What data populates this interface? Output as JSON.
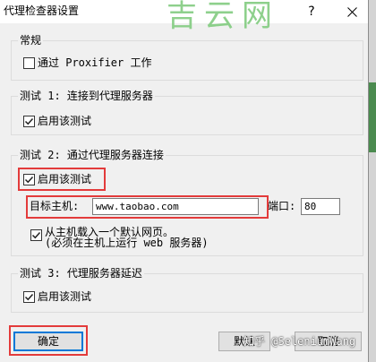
{
  "window": {
    "title": "代理检查器设置",
    "help_button": "?",
    "close_icon": "close-icon"
  },
  "watermarks": {
    "top": "吉云网",
    "bottom": "知乎 @SeleniumWang"
  },
  "groups": {
    "general": {
      "title": "常规",
      "work_through_proxifier": {
        "label": "通过 Proxifier 工作",
        "checked": false
      }
    },
    "test1": {
      "title": "测试 1: 连接到代理服务器",
      "enable": {
        "label": "启用该测试",
        "checked": true
      }
    },
    "test2": {
      "title": "测试 2: 通过代理服务器连接",
      "enable": {
        "label": "启用该测试",
        "checked": true
      },
      "target_host": {
        "label": "目标主机:",
        "value": "www.taobao.com"
      },
      "port": {
        "label": "端口:",
        "value": "80"
      },
      "load_default_page": {
        "label_line1": "从主机载入一个默认网页。",
        "label_line2": "(必须在主机上运行 web 服务器)",
        "checked": true
      }
    },
    "test3": {
      "title": "测试 3: 代理服务器延迟",
      "enable": {
        "label": "启用该测试",
        "checked": true
      }
    }
  },
  "buttons": {
    "ok": "确定",
    "default": "默认",
    "cancel": "取消"
  },
  "icons": {
    "checkbox_mark": "checkmark-icon"
  },
  "colors": {
    "highlight": "#e33b3b",
    "watermark_green": "#82cc80",
    "focus_blue": "#0078d7",
    "background_window_green": "#4b8b4f"
  }
}
